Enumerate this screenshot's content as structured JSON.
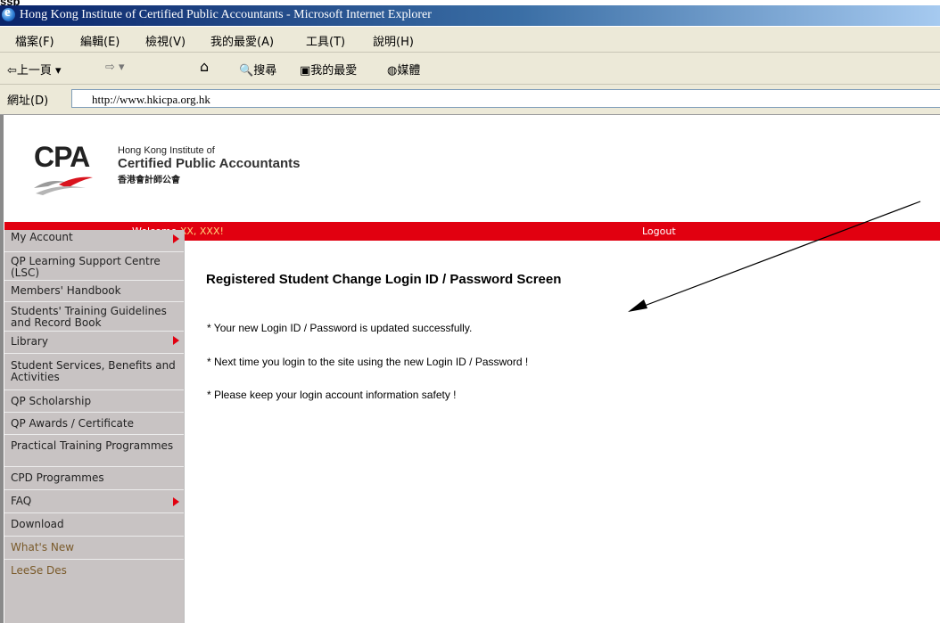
{
  "top_fragment": "ssp",
  "window": {
    "title": "Hong Kong Institute of Certified Public Accountants - Microsoft Internet Explorer"
  },
  "menu": [
    "檔案(F)",
    "編輯(E)",
    "檢視(V)",
    "我的最愛(A)",
    "工具(T)",
    "說明(H)"
  ],
  "toolbar": {
    "back_label": "上一頁",
    "search_label": "搜尋",
    "favorites_label": "我的最愛",
    "media_label": "媒體"
  },
  "address": {
    "label": "網址(D)",
    "url": "http://www.hkicpa.org.hk"
  },
  "header": {
    "logo_word": "CPA",
    "org_line1": "Hong Kong Institute of",
    "org_line2": "Certified Public Accountants",
    "org_line3": "香港會計師公會"
  },
  "redbar": {
    "welcome": "Welcome ",
    "user": "XX, XXX!",
    "logout": "Logout",
    "color": "#e10010"
  },
  "sidebar": {
    "items": [
      {
        "label": "My Account",
        "arrow": true
      },
      {
        "label": "QP Learning Support Centre (LSC)",
        "arrow": false
      },
      {
        "label": "Members' Handbook",
        "arrow": false
      },
      {
        "label": "Students' Training Guidelines and Record Book",
        "arrow": false
      },
      {
        "label": "Library",
        "arrow": true
      },
      {
        "label": "Student Services, Benefits and Activities",
        "arrow": false
      },
      {
        "label": "QP Scholarship",
        "arrow": false
      },
      {
        "label": "QP Awards / Certificate",
        "arrow": false
      },
      {
        "label": "Practical Training Programmes",
        "arrow": false
      },
      {
        "label": "CPD Programmes",
        "arrow": false
      },
      {
        "label": "FAQ",
        "arrow": true
      },
      {
        "label": "Download",
        "arrow": false
      },
      {
        "label": "What's New",
        "arrow": false
      },
      {
        "label": "LeeSe Des",
        "arrow": false
      }
    ]
  },
  "content": {
    "title": "Registered Student Change Login ID / Password Screen",
    "messages": [
      "* Your new Login ID / Password is updated successfully.",
      "* Next time you login to the site using the new Login ID / Password !",
      "* Please keep your login account information safety !"
    ]
  }
}
